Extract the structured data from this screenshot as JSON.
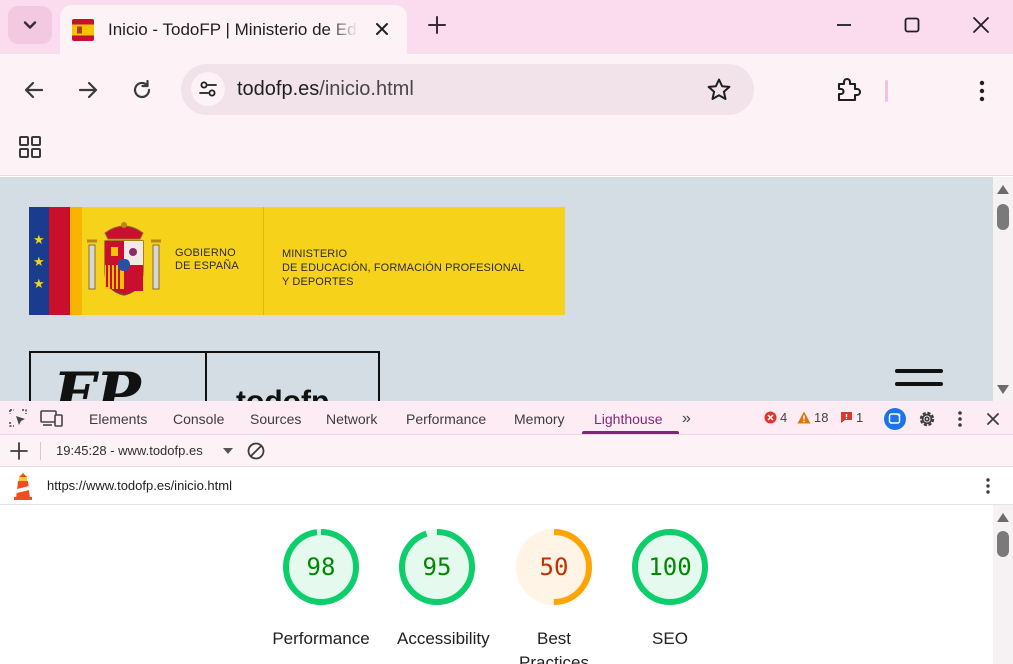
{
  "browser": {
    "tab": {
      "title": "Inicio - TodoFP | Ministerio de Educación, Formación Profesional y Deportes"
    },
    "omnibox": {
      "host": "todofp.es",
      "path": "/inicio.html"
    }
  },
  "page": {
    "gov_banner": {
      "gov_line1": "GOBIERNO",
      "gov_line2": "DE ESPAÑA",
      "ministry_line1": "MINISTERIO",
      "ministry_line2": "DE EDUCACIÓN, FORMACIÓN PROFESIONAL",
      "ministry_line3": "Y DEPORTES"
    },
    "fp_logo": {
      "big": "FP",
      "small": "todofp"
    }
  },
  "devtools": {
    "tabs": [
      "Elements",
      "Console",
      "Sources",
      "Network",
      "Performance",
      "Memory",
      "Lighthouse"
    ],
    "active_tab": "Lighthouse",
    "errors": "4",
    "warnings": "18",
    "issues": "1",
    "report_selector": "19:45:28 - www.todofp.es",
    "audited_url": "https://www.todofp.es/inicio.html"
  },
  "lighthouse": {
    "scores": [
      {
        "value": 98,
        "label": "Performance",
        "status": "pass"
      },
      {
        "value": 95,
        "label": "Accessibility",
        "status": "pass"
      },
      {
        "value": 50,
        "label": "Best Practices",
        "status": "average"
      },
      {
        "value": 100,
        "label": "SEO",
        "status": "pass"
      }
    ],
    "colors": {
      "pass_stroke": "#0cce6b",
      "pass_fill": "#e6f9ee",
      "pass_text": "#008800",
      "average_stroke": "#ffa400",
      "average_fill": "#fff4e6",
      "average_text": "#c33300"
    }
  }
}
